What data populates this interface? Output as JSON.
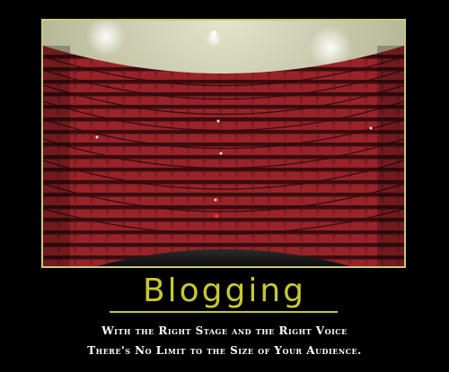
{
  "poster": {
    "title": "Blogging",
    "caption_line1": "With the Right Stage and the Right Voice",
    "caption_line2": "There's No Limit to the Size of Your Audience."
  },
  "colors": {
    "background": "#000000",
    "title": "#c8c830",
    "frame_border": "#c9c97a",
    "caption": "#ffffff",
    "seats": "#8e1f25"
  }
}
